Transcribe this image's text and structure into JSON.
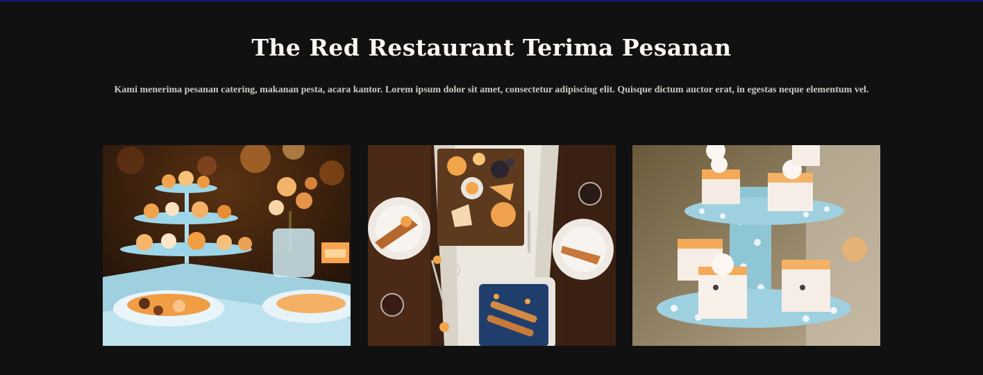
{
  "section": {
    "title": "The Red Restaurant Terima Pesanan",
    "description": "Kami menerima pesanan catering, makanan pesta, acara kantor. Lorem ipsum dolor sit amet, consectetur adipiscing elit. Quisque dictum auctor erat, in egestas neque elementum vel."
  },
  "gallery": {
    "images": [
      {
        "subject": "dessert-buffet-table"
      },
      {
        "subject": "overhead-dinner-table"
      },
      {
        "subject": "cake-tier-stand"
      }
    ]
  },
  "colors": {
    "background": "#121112",
    "title": "#fbf6ef",
    "description": "#cfc9c0",
    "top_rule": "#17148c",
    "accent_orange": "#f0a04b",
    "accent_blue": "#8fc6d6"
  }
}
